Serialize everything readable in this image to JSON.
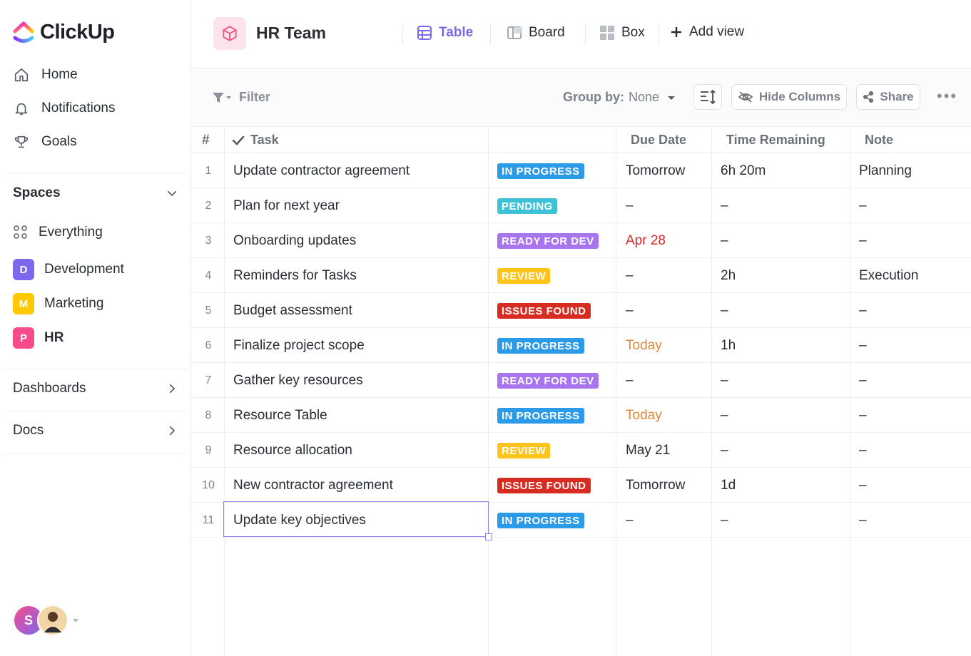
{
  "app": {
    "name": "ClickUp"
  },
  "sidebar": {
    "nav": [
      {
        "label": "Home",
        "icon": "home-icon"
      },
      {
        "label": "Notifications",
        "icon": "bell-icon"
      },
      {
        "label": "Goals",
        "icon": "trophy-icon"
      }
    ],
    "spaces_label": "Spaces",
    "everything_label": "Everything",
    "spaces": [
      {
        "letter": "D",
        "label": "Development",
        "color": "#7b68ee"
      },
      {
        "letter": "M",
        "label": "Marketing",
        "color": "#ffc800"
      },
      {
        "letter": "P",
        "label": "HR",
        "color": "#f74b8c"
      }
    ],
    "dashboards_label": "Dashboards",
    "docs_label": "Docs",
    "user_initial": "S"
  },
  "header": {
    "title": "HR Team",
    "views": [
      {
        "label": "Table",
        "icon": "table-icon",
        "active": true
      },
      {
        "label": "Board",
        "icon": "board-icon",
        "active": false
      },
      {
        "label": "Box",
        "icon": "box-grid-icon",
        "active": false
      }
    ],
    "add_view_label": "Add view"
  },
  "toolbar": {
    "filter_label": "Filter",
    "group_by_label": "Group by:",
    "group_by_value": "None",
    "hide_columns_label": "Hide Columns",
    "share_label": "Share"
  },
  "table": {
    "columns": {
      "num": "#",
      "task": "Task",
      "due": "Due Date",
      "time": "Time Remaining",
      "note": "Note"
    },
    "rows": [
      {
        "num": "1",
        "task": "Update contractor agreement",
        "status": "IN PROGRESS",
        "due": "Tomorrow",
        "time": "6h 20m",
        "note": "Planning"
      },
      {
        "num": "2",
        "task": "Plan for next year",
        "status": "PENDING",
        "due": "–",
        "time": "–",
        "note": "–"
      },
      {
        "num": "3",
        "task": "Onboarding updates",
        "status": "READY FOR DEV",
        "due": "Apr 28",
        "time": "–",
        "note": "–"
      },
      {
        "num": "4",
        "task": "Reminders for Tasks",
        "status": "REVIEW",
        "due": "–",
        "time": "2h",
        "note": "Execution"
      },
      {
        "num": "5",
        "task": "Budget assessment",
        "status": "ISSUES FOUND",
        "due": "–",
        "time": "–",
        "note": "–"
      },
      {
        "num": "6",
        "task": "Finalize project scope",
        "status": "IN PROGRESS",
        "due": "Today",
        "time": "1h",
        "note": "–"
      },
      {
        "num": "7",
        "task": "Gather key resources",
        "status": "READY FOR DEV",
        "due": "–",
        "time": "–",
        "note": "–"
      },
      {
        "num": "8",
        "task": "Resource Table",
        "status": "IN PROGRESS",
        "due": "Today",
        "time": "–",
        "note": "–"
      },
      {
        "num": "9",
        "task": "Resource allocation",
        "status": "REVIEW",
        "due": "May 21",
        "time": "–",
        "note": "–"
      },
      {
        "num": "10",
        "task": "New contractor agreement",
        "status": "ISSUES FOUND",
        "due": "Tomorrow",
        "time": "1d",
        "note": "–"
      },
      {
        "num": "11",
        "task": "Update key objectives",
        "status": "IN PROGRESS",
        "due": "–",
        "time": "–",
        "note": "–"
      }
    ]
  },
  "status_colors": {
    "IN PROGRESS": "#2b9be8",
    "PENDING": "#3dc2d6",
    "READY FOR DEV": "#a875ee",
    "REVIEW": "#ffc41a",
    "ISSUES FOUND": "#d82c20"
  },
  "due_colors": {
    "Apr 28": "#d32b2b",
    "Today": "#e1893b"
  }
}
